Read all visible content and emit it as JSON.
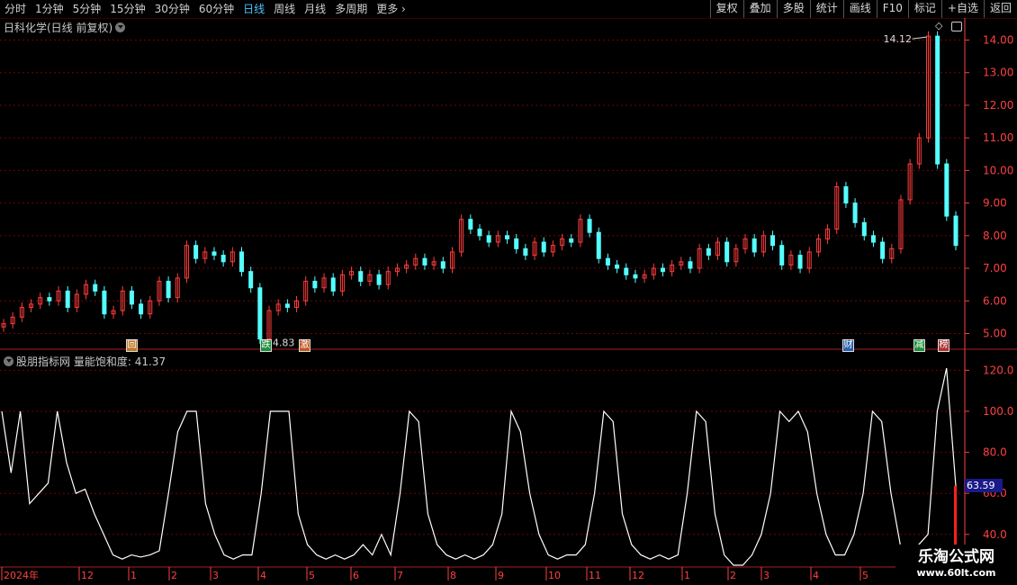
{
  "toolbar": {
    "periods": [
      "分时",
      "1分钟",
      "5分钟",
      "15分钟",
      "30分钟",
      "60分钟",
      "日线",
      "周线",
      "月线",
      "多周期",
      "更多"
    ],
    "active_period": "日线",
    "buttons": [
      "复权",
      "叠加",
      "多股",
      "统计",
      "画线",
      "F10",
      "标记",
      "+自选",
      "返回"
    ]
  },
  "price_panel": {
    "title": "日科化学(日线 前复权)",
    "high_label": "14.12",
    "low_label": "4.83"
  },
  "indicator_panel": {
    "source": "股朋指标网",
    "name": "量能饱和度",
    "value": "41.37",
    "current_tag": "63.59"
  },
  "markers": [
    {
      "label": "回",
      "color": "#c07820"
    },
    {
      "label": "跌",
      "color": "#1a8f3a"
    },
    {
      "label": "激",
      "color": "#c05a20"
    },
    {
      "label": "财",
      "color": "#2a5fb0"
    },
    {
      "label": "减",
      "color": "#1a8f3a"
    },
    {
      "label": "榜",
      "color": "#b03030"
    }
  ],
  "colors": {
    "up": "#ff3c3c",
    "down": "#54ffff",
    "grid": "#7a0000",
    "axis": "#ff4040",
    "indicator": "#ffffff",
    "tag_bg": "#1a1a8a"
  },
  "chart_data": [
    {
      "type": "candlestick",
      "title": "日科化学(日线 前复权)",
      "yticks": [
        5.0,
        6.0,
        7.0,
        8.0,
        9.0,
        10.0,
        11.0,
        12.0,
        13.0,
        14.0
      ],
      "ylim": [
        4.6,
        14.4
      ],
      "grid": true,
      "annotations": [
        {
          "text": "14.12",
          "type": "max"
        },
        {
          "text": "4.83",
          "type": "min"
        }
      ],
      "close_series": [
        5.3,
        5.5,
        5.8,
        5.9,
        6.1,
        6.0,
        6.3,
        5.8,
        6.2,
        6.5,
        6.3,
        5.6,
        5.7,
        6.3,
        5.9,
        5.6,
        6.0,
        6.6,
        6.1,
        6.7,
        7.7,
        7.3,
        7.5,
        7.4,
        7.2,
        7.5,
        6.9,
        6.4,
        4.83,
        5.7,
        5.9,
        5.8,
        6.0,
        6.6,
        6.4,
        6.7,
        6.3,
        6.8,
        6.9,
        6.6,
        6.8,
        6.5,
        6.9,
        7.0,
        7.1,
        7.3,
        7.1,
        7.2,
        7.0,
        7.5,
        8.5,
        8.2,
        8.0,
        7.8,
        8.0,
        7.9,
        7.6,
        7.4,
        7.8,
        7.5,
        7.7,
        7.9,
        7.8,
        8.5,
        8.1,
        7.3,
        7.1,
        7.0,
        6.8,
        6.7,
        6.8,
        7.0,
        6.9,
        7.1,
        7.2,
        7.0,
        7.6,
        7.4,
        7.8,
        7.2,
        7.6,
        7.9,
        7.5,
        8.0,
        7.7,
        7.1,
        7.4,
        7.0,
        7.5,
        7.9,
        8.2,
        9.5,
        9.0,
        8.4,
        8.0,
        7.8,
        7.3,
        7.6,
        9.1,
        10.2,
        11.0,
        14.12,
        10.2,
        8.6,
        7.7
      ]
    },
    {
      "type": "line",
      "title": "量能饱和度",
      "yticks": [
        40.0,
        60.0,
        80.0,
        100.0,
        120.0
      ],
      "ylim": [
        25,
        125
      ],
      "current_value": 63.59,
      "series": [
        {
          "name": "量能饱和度",
          "values": [
            100,
            70,
            100,
            55,
            60,
            65,
            100,
            75,
            60,
            62,
            50,
            40,
            30,
            28,
            30,
            29,
            30,
            32,
            60,
            90,
            100,
            100,
            55,
            40,
            30,
            28,
            30,
            30,
            60,
            100,
            100,
            100,
            50,
            35,
            30,
            28,
            30,
            28,
            30,
            35,
            30,
            40,
            30,
            60,
            100,
            95,
            50,
            35,
            30,
            28,
            30,
            28,
            30,
            35,
            50,
            100,
            90,
            60,
            40,
            30,
            28,
            30,
            30,
            35,
            60,
            100,
            95,
            50,
            35,
            30,
            28,
            30,
            28,
            30,
            60,
            100,
            95,
            50,
            30,
            25,
            25,
            30,
            40,
            60,
            100,
            95,
            100,
            90,
            60,
            40,
            30,
            30,
            40,
            60,
            100,
            95,
            60,
            35,
            30,
            35,
            40,
            100,
            121,
            63.59
          ]
        }
      ]
    },
    {
      "type": "axis",
      "xticks": [
        "2024年",
        "12",
        "1",
        "2",
        "3",
        "4",
        "5",
        "6",
        "7",
        "8",
        "9",
        "10",
        "11",
        "12",
        "1",
        "2",
        "3",
        "4",
        "5"
      ]
    }
  ]
}
